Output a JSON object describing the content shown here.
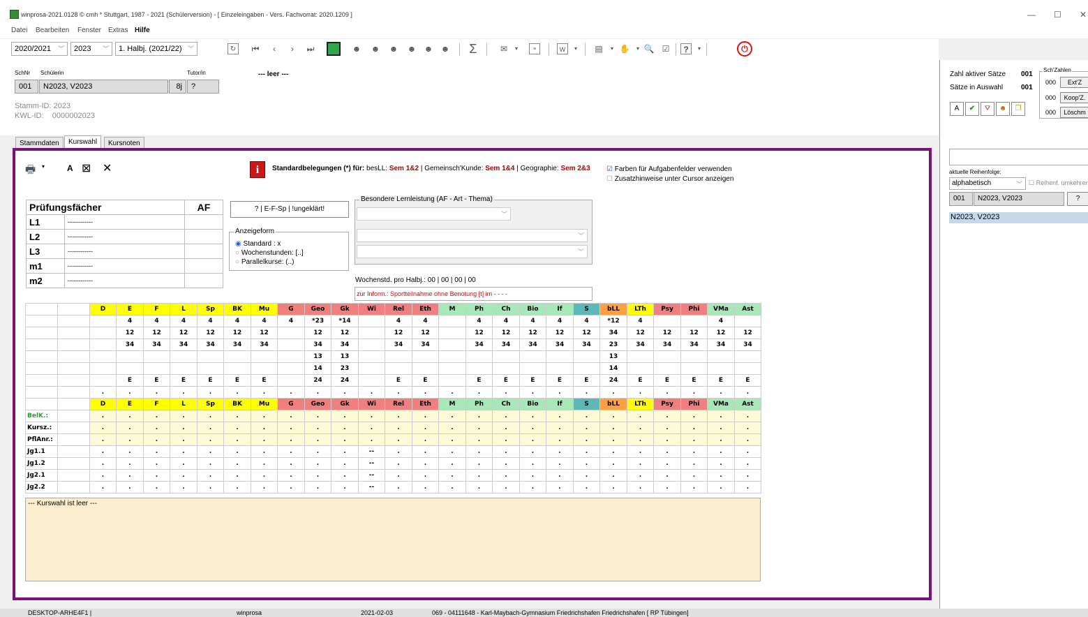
{
  "window": {
    "title": "winprosa-2021.0128 © cmh * Stuttgart, 1987 - 2021 (Schülerversion) - [ Einzeleingaben - Vers. Fachvorrat: 2020.1209 ]",
    "minimize": "—",
    "maximize": "☐",
    "close": "✕"
  },
  "menu": [
    "Datei",
    "Bearbeiten",
    "Fenster",
    "Extras",
    "Hilfe"
  ],
  "toolbar": {
    "school_year": "2020/2021",
    "year": "2023",
    "halfyear": "1. Halbj. (2021/22)"
  },
  "student": {
    "schnr_label": "SchNr",
    "name_label": "Schülerin",
    "tutor_label": "Tutor/in",
    "schnr": "001",
    "name": "N2023, V2023",
    "class": "8j",
    "tutor": "?",
    "leer": "--- leer ---",
    "stamm_id": "Stamm-ID:  2023",
    "kwl_id": "KWL-ID:    0000002023"
  },
  "tabs": [
    "Stammdaten",
    "Kurswahl",
    "Kursnoten"
  ],
  "kurswahl": {
    "tool_a": "A",
    "tool_x1": "⊠",
    "tool_x2": "✕",
    "info_icon": "i",
    "std_label": "Standardbelegungen (*) für:",
    "std_text_1": " besLL: ",
    "std_sem_1": "Sem 1&2",
    "std_text_2": " | Gemeinsch'Kunde: ",
    "std_sem_2": "Sem 1&4",
    "std_text_3": " | Geographie: ",
    "std_sem_3": "Sem 2&3",
    "cb_farben": "Farben für Aufgabenfelder verwenden",
    "cb_zusatz": "Zusatzhinweise unter Cursor anzeigen",
    "pf_header": "Prüfungsfächer",
    "af_header": "AF",
    "pf_rows": [
      {
        "label": "L1",
        "value": "------------"
      },
      {
        "label": "L2",
        "value": "------------"
      },
      {
        "label": "L3",
        "value": "------------"
      },
      {
        "label": "m1",
        "value": "------------"
      },
      {
        "label": "m2",
        "value": "------------"
      }
    ],
    "efsp_button": "? | E-F-Sp | !ungeklärt!",
    "anzeige_title": "Anzeigeform",
    "anzeige_opts": [
      "Standard : x",
      "Wochenstunden: [..]",
      "Parallelkurse: (..)"
    ],
    "bll_title": "Besondere Lernleistung (AF - Art - Thema)",
    "wochenstd": "Wochenstd. pro Halbj.: 00 | 00 | 00 | 00",
    "zur_inform": "zur Inform.: Sportteilnahme ohne Benotung [t] im -      -      -      -",
    "notes": "--- Kurswahl ist leer ---"
  },
  "grid": {
    "subjects": [
      "D",
      "E",
      "F",
      "L",
      "Sp",
      "BK",
      "Mu",
      "G",
      "Geo",
      "Gk",
      "Wi",
      "Rel",
      "Eth",
      "M",
      "Ph",
      "Ch",
      "Bio",
      "If",
      "S",
      "bLL",
      "LTh",
      "Psy",
      "Phi",
      "VMa",
      "Ast"
    ],
    "colors": [
      "#ffff00",
      "#ffff00",
      "#ffff00",
      "#ffff00",
      "#ffff00",
      "#ffff00",
      "#ffff00",
      "#f08080",
      "#f08080",
      "#f08080",
      "#f08080",
      "#f08080",
      "#f08080",
      "#a8e8b8",
      "#a8e8b8",
      "#a8e8b8",
      "#a8e8b8",
      "#a8e8b8",
      "#5fb8b8",
      "#ffa040",
      "#ffff00",
      "#f08080",
      "#f08080",
      "#a8e8b8",
      "#a8e8b8"
    ],
    "rows": [
      [
        "",
        "4",
        "4",
        "4",
        "4",
        "4",
        "4",
        "4",
        "*23",
        "*14",
        "",
        "4",
        "4",
        "",
        "4",
        "4",
        "4",
        "4",
        "4",
        "*12",
        "4",
        "",
        "",
        "4",
        ""
      ],
      [
        "",
        "12",
        "12",
        "12",
        "12",
        "12",
        "12",
        "",
        "12",
        "12",
        "",
        "12",
        "12",
        "",
        "12",
        "12",
        "12",
        "12",
        "12",
        "34",
        "12",
        "12",
        "12",
        "12",
        "12"
      ],
      [
        "",
        "34",
        "34",
        "34",
        "34",
        "34",
        "34",
        "",
        "34",
        "34",
        "",
        "34",
        "34",
        "",
        "34",
        "34",
        "34",
        "34",
        "34",
        "23",
        "34",
        "34",
        "34",
        "34",
        "34"
      ],
      [
        "",
        "",
        "",
        "",
        "",
        "",
        "",
        "",
        "13",
        "13",
        "",
        "",
        "",
        "",
        "",
        "",
        "",
        "",
        "",
        "13",
        "",
        "",
        "",
        "",
        ""
      ],
      [
        "",
        "",
        "",
        "",
        "",
        "",
        "",
        "",
        "14",
        "23",
        "",
        "",
        "",
        "",
        "",
        "",
        "",
        "",
        "",
        "14",
        "",
        "",
        "",
        "",
        ""
      ],
      [
        "",
        "E",
        "E",
        "E",
        "E",
        "E",
        "E",
        "",
        "24",
        "24",
        "",
        "E",
        "E",
        "",
        "E",
        "E",
        "E",
        "E",
        "E",
        "24",
        "E",
        "E",
        "E",
        "E",
        "E"
      ],
      [
        ".",
        ".",
        ".",
        ".",
        ".",
        ".",
        ".",
        ".",
        ".",
        ".",
        ".",
        ".",
        ".",
        ".",
        ".",
        ".",
        ".",
        ".",
        ".",
        ".",
        ".",
        ".",
        ".",
        ".",
        "."
      ]
    ],
    "lower_labels": [
      "BelK.:",
      "Kursz.:",
      "PflAnr.:",
      "Jg1.1",
      "Jg1.2",
      "Jg2.1",
      "Jg2.2"
    ],
    "dot": ".",
    "dash": "--"
  },
  "right": {
    "zahl_aktiv": "Zahl aktiver Sätze",
    "zahl_aktiv_val": "001",
    "saetze_auswahl": "Sätze in Auswahl",
    "saetze_auswahl_val": "001",
    "sch_zahlen": "Sch'Zahlen",
    "ext_val": "000",
    "ext_btn": "Ext'Z",
    "koop_val": "000",
    "koop_btn": "Koop'Z.",
    "loesch_val": "000",
    "loesch_btn": "Löschm",
    "btn_a": "A",
    "reihenfolge_label": "aktuelle Reihenfolge:",
    "reihenfolge": "alphabetisch",
    "umkehren": "Reihenf. umkehren",
    "sel_nr": "001",
    "sel_name": "N2023, V2023",
    "q": "?",
    "list_item": "N2023, V2023"
  },
  "status": {
    "host": "DESKTOP-ARHE4F1 |",
    "app": "winprosa",
    "date": "2021-02-03",
    "school": "069 - 04111648 - Karl-Maybach-Gymnasium Friedrichshafen Friedrichshafen [ RP Tübingen]"
  }
}
